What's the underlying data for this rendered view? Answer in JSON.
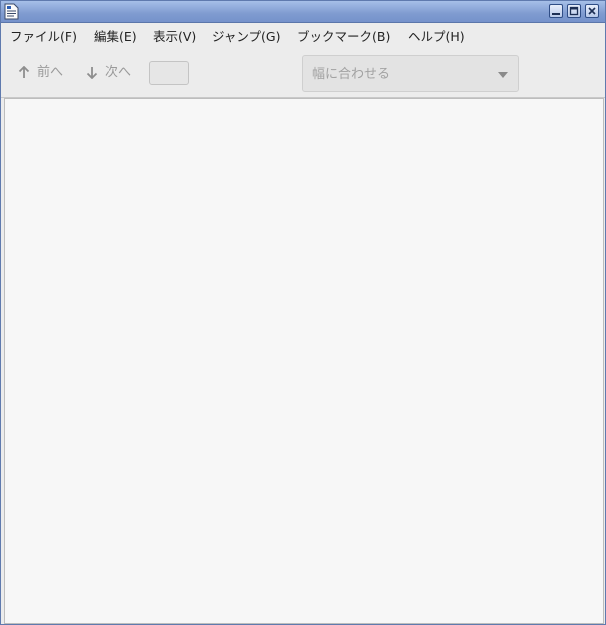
{
  "window": {
    "app_icon": "document-viewer-icon",
    "controls": [
      "minimize-icon",
      "maximize-icon",
      "close-icon"
    ]
  },
  "menu": {
    "file": "ファイル(F)",
    "edit": "編集(E)",
    "view": "表示(V)",
    "go": "ジャンプ(G)",
    "bookmarks": "ブックマーク(B)",
    "help": "ヘルプ(H)"
  },
  "toolbar": {
    "prev_label": "前へ",
    "next_label": "次へ",
    "prev_icon": "arrow-up-icon",
    "next_icon": "arrow-down-icon",
    "page_value": "",
    "zoom_value": "幅に合わせる",
    "zoom_arrow_icon": "dropdown-arrow-icon"
  },
  "colors": {
    "titlebar": "#7f9bd0",
    "background": "#ececec",
    "document_area": "#f7f7f7",
    "disabled_text": "#9a9a9a"
  }
}
